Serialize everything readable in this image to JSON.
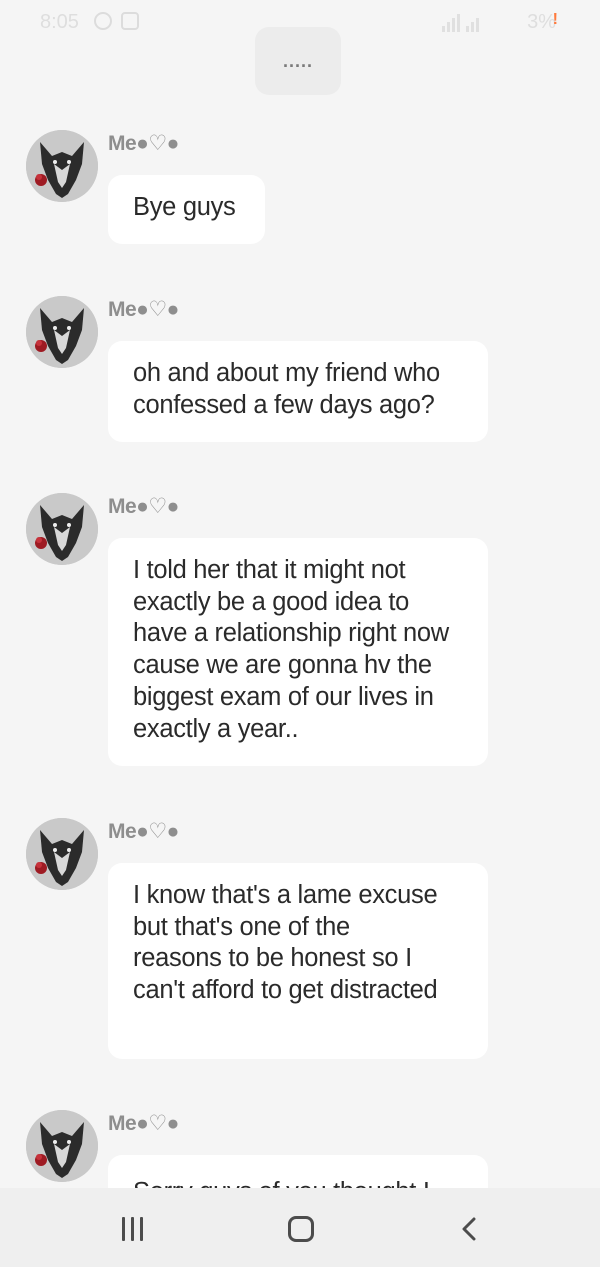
{
  "status_bar": {
    "time": "8:05",
    "battery": "3%",
    "warning": "!"
  },
  "top_pill": {
    "label": "....."
  },
  "messages": [
    {
      "sender": "Me●♡●",
      "text": "Bye guys"
    },
    {
      "sender": "Me●♡●",
      "text": "oh and about my friend who confessed a few days ago?"
    },
    {
      "sender": "Me●♡●",
      "text": "I told her that it might not exactly be a good idea to have a relationship right now cause we are gonna hv the biggest exam of our lives in exactly a year.."
    },
    {
      "sender": "Me●♡●",
      "text": "I know that's a lame excuse but that's one of the reasons to be honest so I can't afford to get distracted"
    },
    {
      "sender": "Me●♡●",
      "text": "Sorry guys of you thought I"
    }
  ],
  "icons": {
    "avatar": "wolf-avatar-icon",
    "recents": "recent-apps-icon",
    "home": "home-icon",
    "back": "back-chevron-icon"
  },
  "colors": {
    "background": "#f5f5f5",
    "bubble": "#ffffff",
    "sender": "#8e8e8e",
    "text": "#2a2a2a",
    "nav_bar": "#efefef"
  }
}
